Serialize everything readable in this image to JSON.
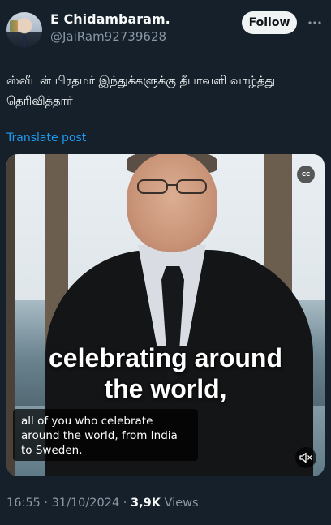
{
  "author": {
    "display_name": "E Chidambaram.",
    "handle": "@JaiRam92739628",
    "follow_label": "Follow"
  },
  "tweet": {
    "text": "ஸ்வீடன் பிரதமர் இந்துக்களுக்கு தீபாவளி வாழ்த்து தெரிவித்தார்",
    "translate_label": "Translate post"
  },
  "video": {
    "cc_label": "CC",
    "overlay_caption_line1": "celebrating around",
    "overlay_caption_line2": "the world,",
    "subtitle": "all of you who celebrate around the world, from India to Sweden."
  },
  "meta": {
    "timestamp": "16:55 · 31/10/2024 · ",
    "views_count": "3,9K",
    "views_label": " Views"
  },
  "icons": {
    "more": "more-horizontal-icon",
    "cc": "closed-captions-icon",
    "mute": "muted-speaker-icon"
  },
  "colors": {
    "background": "#15202b",
    "link": "#1d9bf0",
    "secondary_text": "#8b98a5"
  }
}
